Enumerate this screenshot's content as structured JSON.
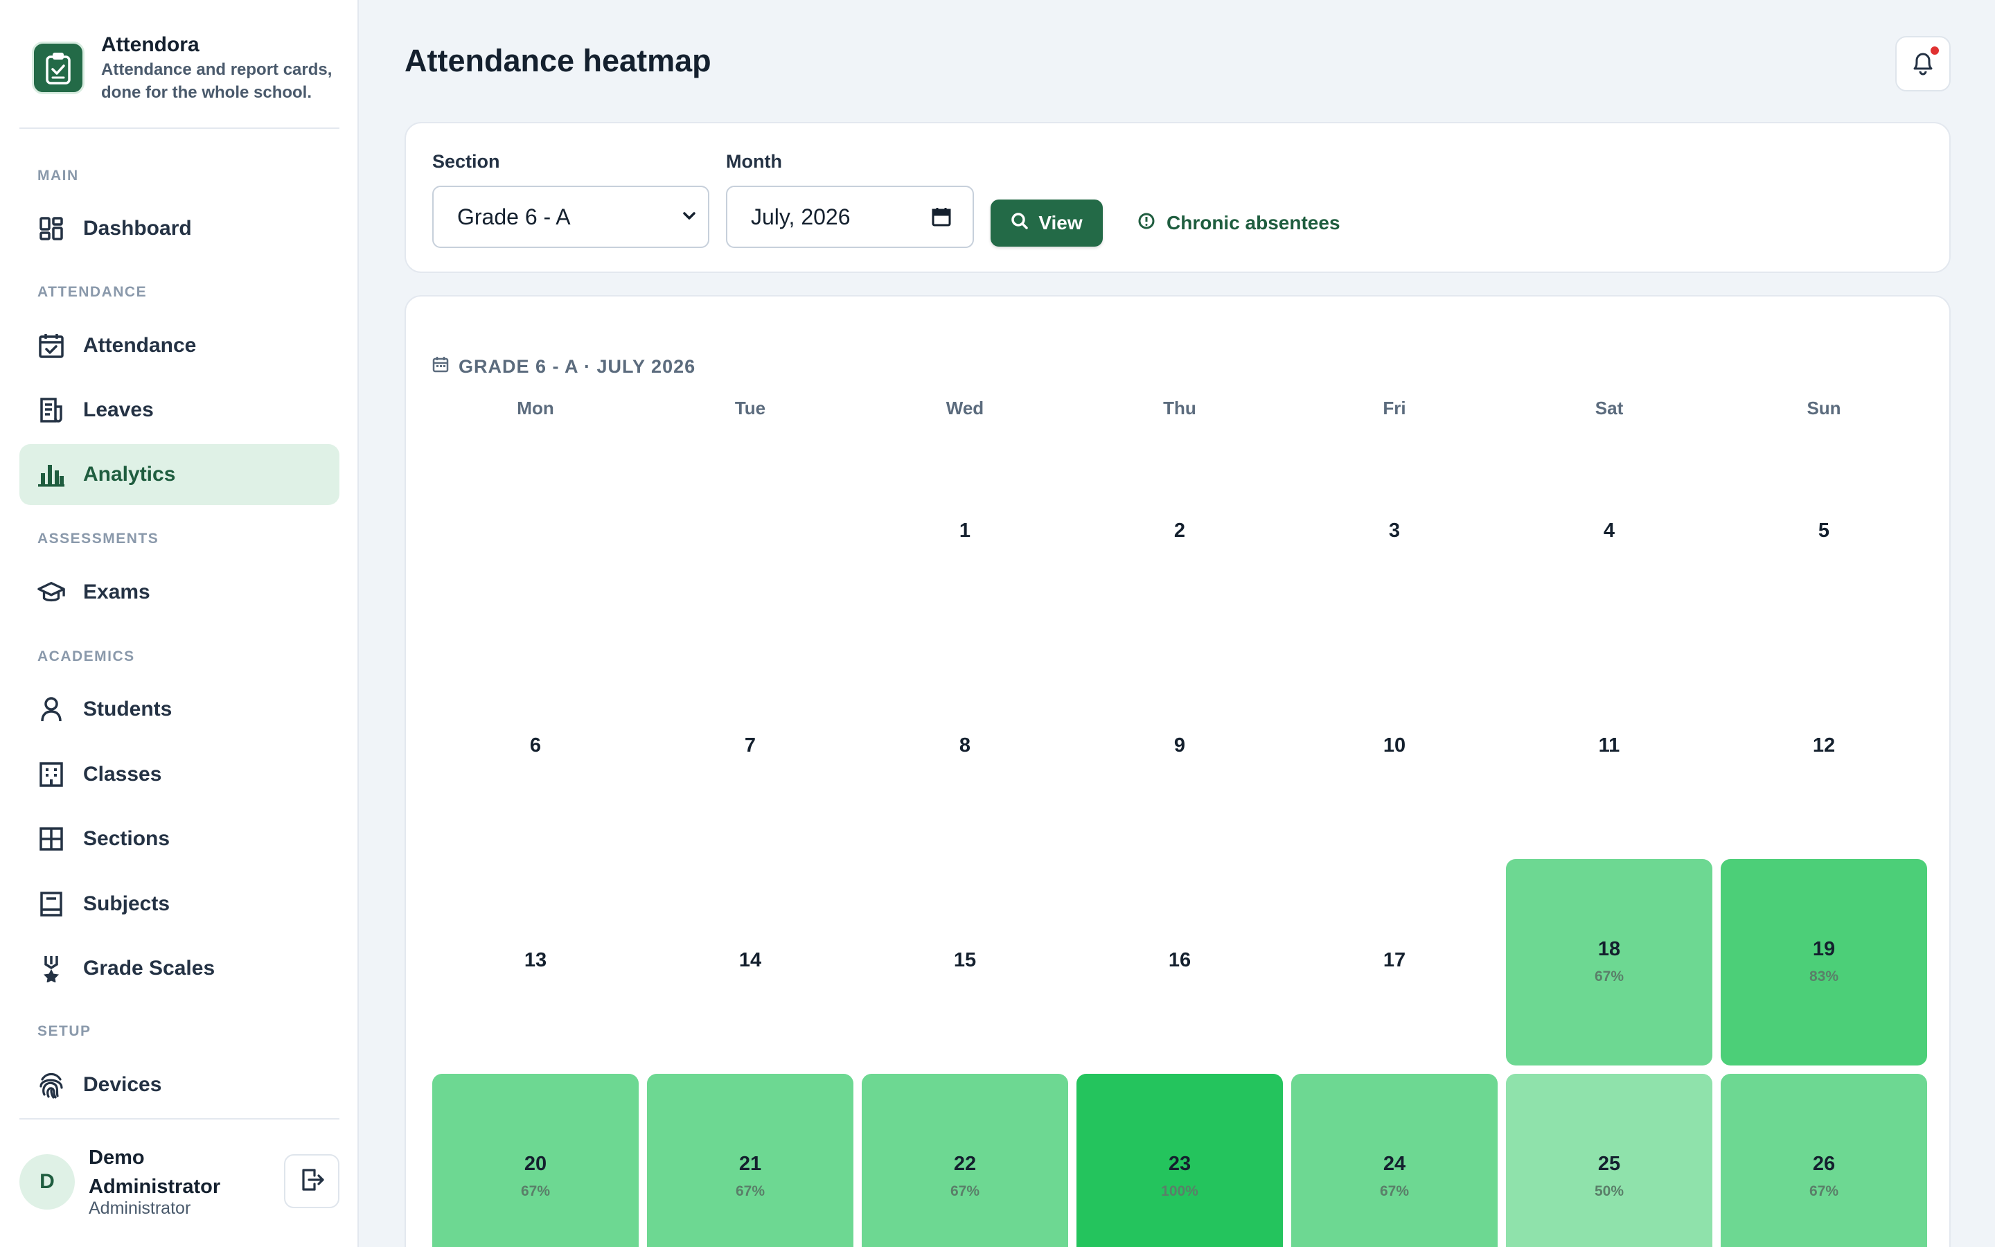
{
  "brand": {
    "name": "Attendora",
    "tagline": "Attendance and report cards, done for the whole school."
  },
  "nav": {
    "sections": [
      {
        "label": "MAIN",
        "items": [
          {
            "label": "Dashboard",
            "icon": "dashboard-icon"
          }
        ]
      },
      {
        "label": "ATTENDANCE",
        "items": [
          {
            "label": "Attendance",
            "icon": "calendar-check-icon"
          },
          {
            "label": "Leaves",
            "icon": "document-icon"
          },
          {
            "label": "Analytics",
            "icon": "bar-chart-icon",
            "active": true
          }
        ]
      },
      {
        "label": "ASSESSMENTS",
        "items": [
          {
            "label": "Exams",
            "icon": "graduation-cap-icon"
          }
        ]
      },
      {
        "label": "ACADEMICS",
        "items": [
          {
            "label": "Students",
            "icon": "person-icon"
          },
          {
            "label": "Classes",
            "icon": "building-icon"
          },
          {
            "label": "Sections",
            "icon": "grid-icon"
          },
          {
            "label": "Subjects",
            "icon": "book-icon"
          },
          {
            "label": "Grade Scales",
            "icon": "medal-icon"
          }
        ]
      },
      {
        "label": "SETUP",
        "items": [
          {
            "label": "Devices",
            "icon": "fingerprint-icon"
          }
        ]
      }
    ]
  },
  "user": {
    "initial": "D",
    "name": "Demo Administrator",
    "role": "Administrator"
  },
  "page": {
    "title": "Attendance heatmap"
  },
  "filters": {
    "section_label": "Section",
    "section_value": "Grade 6 - A",
    "month_label": "Month",
    "month_value": "July, 2026",
    "view_label": "View",
    "chronic_label": "Chronic absentees"
  },
  "calendar": {
    "title": "GRADE 6 - A · JULY 2026",
    "weekdays": [
      "Mon",
      "Tue",
      "Wed",
      "Thu",
      "Fri",
      "Sat",
      "Sun"
    ],
    "first_weekday_index": 2,
    "days": [
      {
        "day": "1"
      },
      {
        "day": "2"
      },
      {
        "day": "3"
      },
      {
        "day": "4"
      },
      {
        "day": "5"
      },
      {
        "day": "6"
      },
      {
        "day": "7"
      },
      {
        "day": "8"
      },
      {
        "day": "9"
      },
      {
        "day": "10"
      },
      {
        "day": "11"
      },
      {
        "day": "12"
      },
      {
        "day": "13"
      },
      {
        "day": "14"
      },
      {
        "day": "15"
      },
      {
        "day": "16"
      },
      {
        "day": "17"
      },
      {
        "day": "18",
        "pct": "67%",
        "value": 67
      },
      {
        "day": "19",
        "pct": "83%",
        "value": 83
      },
      {
        "day": "20",
        "pct": "67%",
        "value": 67
      },
      {
        "day": "21",
        "pct": "67%",
        "value": 67
      },
      {
        "day": "22",
        "pct": "67%",
        "value": 67
      },
      {
        "day": "23",
        "pct": "100%",
        "value": 100
      },
      {
        "day": "24",
        "pct": "67%",
        "value": 67
      },
      {
        "day": "25",
        "pct": "50%",
        "value": 50
      },
      {
        "day": "26",
        "pct": "67%",
        "value": 67
      }
    ],
    "colors": {
      "50": "#8fe2ab",
      "67": "#6dd892",
      "83": "#4ccf78",
      "100": "#24c45d"
    }
  }
}
